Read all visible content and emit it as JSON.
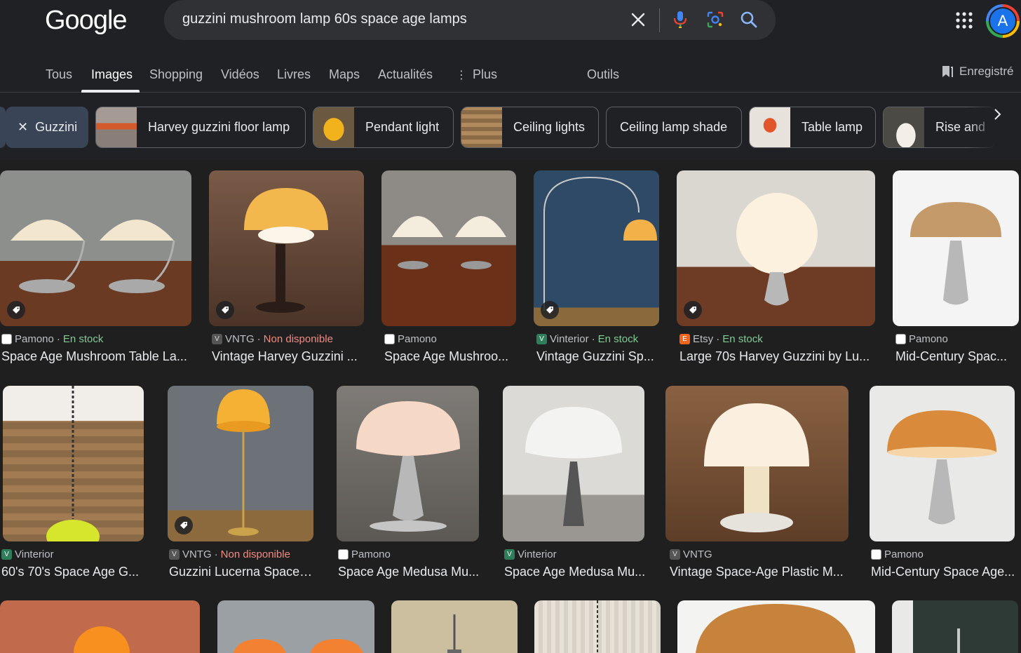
{
  "header": {
    "logo": "Google",
    "query": "guzzini mushroom lamp 60s space age lamps",
    "avatar_letter": "A"
  },
  "tabs": [
    {
      "label": "Tous"
    },
    {
      "label": "Images"
    },
    {
      "label": "Shopping"
    },
    {
      "label": "Vidéos"
    },
    {
      "label": "Livres"
    },
    {
      "label": "Maps"
    },
    {
      "label": "Actualités"
    },
    {
      "label": "Plus"
    },
    {
      "label": "Outils"
    }
  ],
  "saved_label": "Enregistré",
  "chips": [
    {
      "label": "Guzzini"
    },
    {
      "label": "Harvey guzzini floor lamp"
    },
    {
      "label": "Pendant light"
    },
    {
      "label": "Ceiling lights"
    },
    {
      "label": "Ceiling lamp shade"
    },
    {
      "label": "Table lamp"
    },
    {
      "label": "Rise and"
    }
  ],
  "results_row1": [
    {
      "source": "Pamono",
      "status": "En stock",
      "title": "Space Age Mushroom Table La..."
    },
    {
      "source": "VNTG",
      "status": "Non disponible",
      "title": "Vintage Harvey Guzzini ..."
    },
    {
      "source": "Pamono",
      "status": "",
      "title": "Space Age Mushroo..."
    },
    {
      "source": "Vinterior",
      "status": "En stock",
      "title": "Vintage Guzzini Sp..."
    },
    {
      "source": "Etsy",
      "status": "En stock",
      "title": "Large 70s Harvey Guzzini by Lu..."
    },
    {
      "source": "Pamono",
      "status": "",
      "title": "Mid-Century Spac..."
    }
  ],
  "results_row2": [
    {
      "source": "Vinterior",
      "status": "",
      "title": "60's 70's Space Age G..."
    },
    {
      "source": "VNTG",
      "status": "Non disponible",
      "title": "Guzzini Lucerna Space ..."
    },
    {
      "source": "Pamono",
      "status": "",
      "title": "Space Age Medusa Mu..."
    },
    {
      "source": "Vinterior",
      "status": "",
      "title": "Space Age Medusa Mu..."
    },
    {
      "source": "VNTG",
      "status": "",
      "title": "Vintage Space-Age Plastic M..."
    },
    {
      "source": "Pamono",
      "status": "",
      "title": "Mid-Century Space Age..."
    }
  ],
  "separator": "·",
  "colors": {
    "accent": "#8ab4f8",
    "in_stock": "#81c995",
    "unavailable": "#f28b82"
  }
}
